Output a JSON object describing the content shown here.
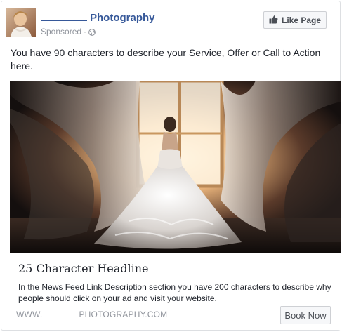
{
  "header": {
    "page_name_suffix": "Photography",
    "sponsored_label": "Sponsored",
    "separator": "·",
    "globe_icon": "globe-icon",
    "like_button_label": "Like Page",
    "like_icon": "thumbs-up-icon"
  },
  "post": {
    "text": "You have 90 characters to describe your Service, Offer or Call to Action here."
  },
  "link": {
    "headline": "25 Character Headline",
    "description": "In the News Feed Link Description section you have 200 characters to describe why people should click on your ad and visit your website.",
    "domain_prefix": "WWW.",
    "domain_suffix": "PHOTOGRAPHY.COM",
    "cta_label": "Book Now"
  },
  "colors": {
    "page_name": "#365899",
    "meta_text": "#90949c",
    "button_bg": "#f6f7f9",
    "button_border": "#ced0d4"
  }
}
